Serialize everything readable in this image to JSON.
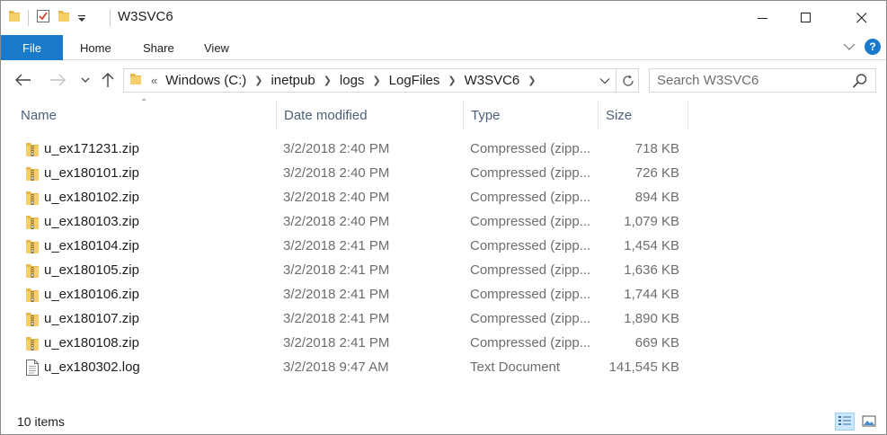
{
  "window": {
    "title": "W3SVC6"
  },
  "ribbon": {
    "tabs": [
      "File",
      "Home",
      "Share",
      "View"
    ],
    "help_label": "?"
  },
  "address": {
    "overflow": "«",
    "crumbs": [
      "Windows (C:)",
      "inetpub",
      "logs",
      "LogFiles",
      "W3SVC6"
    ]
  },
  "search": {
    "placeholder": "Search W3SVC6"
  },
  "columns": {
    "name": "Name",
    "date": "Date modified",
    "type": "Type",
    "size": "Size"
  },
  "files": [
    {
      "icon": "zip-folder-icon",
      "name": "u_ex171231.zip",
      "date": "3/2/2018 2:40 PM",
      "type": "Compressed (zipp...",
      "size": "718 KB"
    },
    {
      "icon": "zip-folder-icon",
      "name": "u_ex180101.zip",
      "date": "3/2/2018 2:40 PM",
      "type": "Compressed (zipp...",
      "size": "726 KB"
    },
    {
      "icon": "zip-folder-icon",
      "name": "u_ex180102.zip",
      "date": "3/2/2018 2:40 PM",
      "type": "Compressed (zipp...",
      "size": "894 KB"
    },
    {
      "icon": "zip-folder-icon",
      "name": "u_ex180103.zip",
      "date": "3/2/2018 2:40 PM",
      "type": "Compressed (zipp...",
      "size": "1,079 KB"
    },
    {
      "icon": "zip-folder-icon",
      "name": "u_ex180104.zip",
      "date": "3/2/2018 2:41 PM",
      "type": "Compressed (zipp...",
      "size": "1,454 KB"
    },
    {
      "icon": "zip-folder-icon",
      "name": "u_ex180105.zip",
      "date": "3/2/2018 2:41 PM",
      "type": "Compressed (zipp...",
      "size": "1,636 KB"
    },
    {
      "icon": "zip-folder-icon",
      "name": "u_ex180106.zip",
      "date": "3/2/2018 2:41 PM",
      "type": "Compressed (zipp...",
      "size": "1,744 KB"
    },
    {
      "icon": "zip-folder-icon",
      "name": "u_ex180107.zip",
      "date": "3/2/2018 2:41 PM",
      "type": "Compressed (zipp...",
      "size": "1,890 KB"
    },
    {
      "icon": "zip-folder-icon",
      "name": "u_ex180108.zip",
      "date": "3/2/2018 2:41 PM",
      "type": "Compressed (zipp...",
      "size": "669 KB"
    },
    {
      "icon": "text-document-icon",
      "name": "u_ex180302.log",
      "date": "3/2/2018 9:47 AM",
      "type": "Text Document",
      "size": "141,545 KB"
    }
  ],
  "status": {
    "item_count": "10 items"
  },
  "colors": {
    "accent": "#1979ca",
    "folder": "#e8b84a",
    "header_text": "#4c607a",
    "secondary_text": "#6d6d6d"
  }
}
